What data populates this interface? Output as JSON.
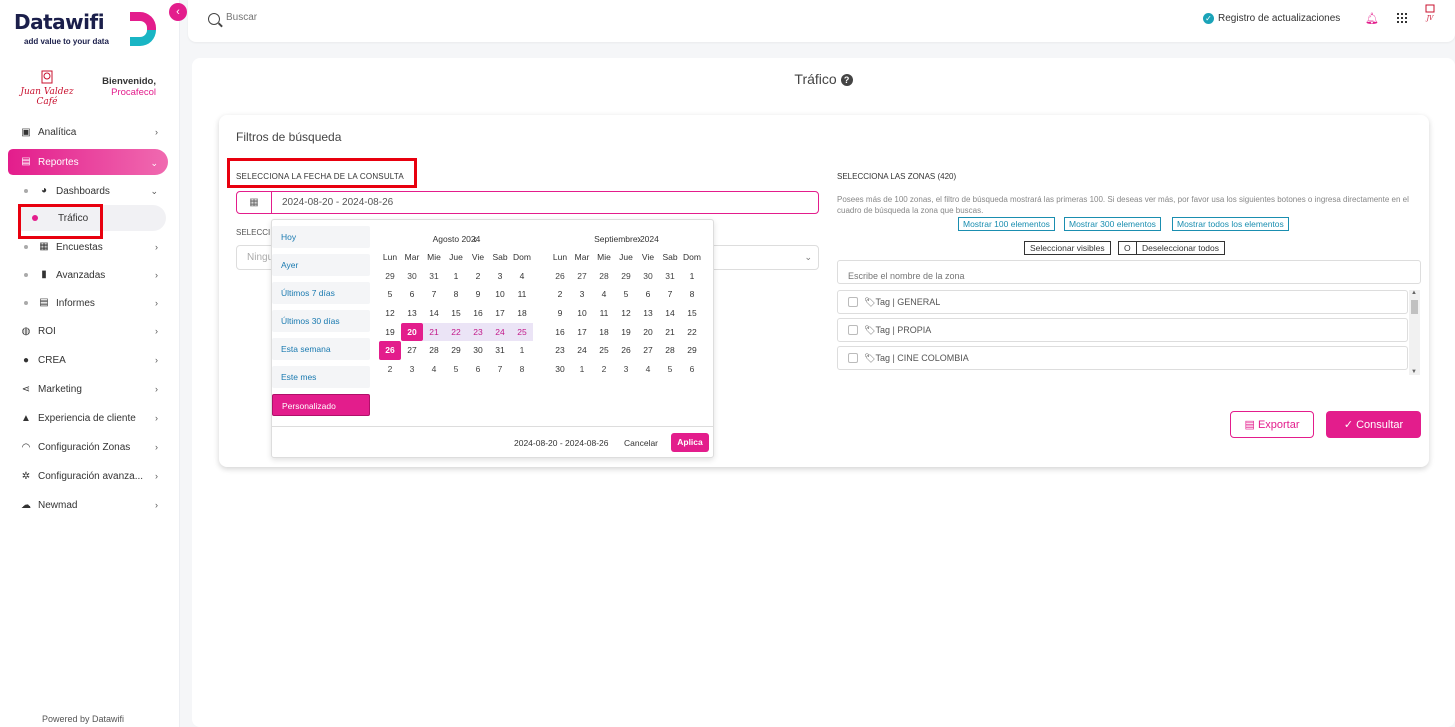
{
  "app": {
    "logo_text": "Datawifi",
    "logo_tagline": "add value to your data",
    "brand_name": "Juan Valdez Café",
    "welcome": "Bienvenido,",
    "company": "Procafecol",
    "powered_by": "Powered by Datawifi",
    "accent_color": "#e31d8c"
  },
  "topbar": {
    "search_placeholder": "Buscar",
    "updates_label": "Registro de actualizaciones"
  },
  "sidebar": {
    "items": [
      {
        "label": "Analítica",
        "icon": "chart-icon"
      },
      {
        "label": "Reportes",
        "icon": "document-icon"
      },
      {
        "label": "Dashboards",
        "icon": "speedometer-icon"
      },
      {
        "label": "Tráfico"
      },
      {
        "label": "Encuestas",
        "icon": "clipboard-icon"
      },
      {
        "label": "Avanzadas",
        "icon": "bar-chart-icon"
      },
      {
        "label": "Informes",
        "icon": "report-icon"
      },
      {
        "label": "ROI",
        "icon": "money-icon"
      },
      {
        "label": "CREA",
        "icon": "lightbulb-icon"
      },
      {
        "label": "Marketing",
        "icon": "share-icon"
      },
      {
        "label": "Experiencia de cliente",
        "icon": "thumbs-up-icon"
      },
      {
        "label": "Configuración Zonas",
        "icon": "wifi-icon"
      },
      {
        "label": "Configuración avanza...",
        "icon": "gear-icon"
      },
      {
        "label": "Newmad",
        "icon": "cloud-icon"
      }
    ]
  },
  "page": {
    "title": "Tráfico",
    "filters_title": "Filtros de búsqueda",
    "date_label": "SELECCIONA LA FECHA DE LA CONSULTA",
    "date_value": "2024-08-20 - 2024-08-26",
    "second_label": "SELECCI",
    "second_placeholder": "Ningu",
    "zones_label": "SELECCIONA LAS ZONAS (420)",
    "zones_hint": "Posees más de 100 zonas, el filtro de búsqueda mostrará las primeras 100. Si deseas ver más, por favor usa los siguientes botones o ingresa directamente en el cuadro de búsqueda la zona que buscas.",
    "show_100": "Mostrar 100 elementos",
    "show_300": "Mostrar 300 elementos",
    "show_all": "Mostrar todos los elementos",
    "select_visible": "Seleccionar visibles",
    "or": "O",
    "deselect_all": "Deseleccionar todos",
    "zone_search_placeholder": "Escribe el nombre de la zona",
    "zones": [
      "Tag | GENERAL",
      "Tag | PROPIA",
      "Tag | CINE COLOMBIA"
    ],
    "export_label": "Exportar",
    "consult_label": "Consultar"
  },
  "picker": {
    "ranges": [
      "Hoy",
      "Ayer",
      "Últimos 7 días",
      "Últimos 30 días",
      "Esta semana",
      "Este mes",
      "Personalizado"
    ],
    "active_range": "Personalizado",
    "weekdays": [
      "Lun",
      "Mar",
      "Mie",
      "Jue",
      "Vie",
      "Sab",
      "Dom"
    ],
    "left_month": "Agosto 2024",
    "right_month": "Septiembre 2024",
    "left_days": [
      "29",
      "30",
      "31",
      "1",
      "2",
      "3",
      "4",
      "5",
      "6",
      "7",
      "8",
      "9",
      "10",
      "11",
      "12",
      "13",
      "14",
      "15",
      "16",
      "17",
      "18",
      "19",
      "20",
      "21",
      "22",
      "23",
      "24",
      "25",
      "26",
      "27",
      "28",
      "29",
      "30",
      "31",
      "1",
      "2",
      "3",
      "4",
      "5",
      "6",
      "7",
      "8"
    ],
    "right_days": [
      "26",
      "27",
      "28",
      "29",
      "30",
      "31",
      "1",
      "2",
      "3",
      "4",
      "5",
      "6",
      "7",
      "8",
      "9",
      "10",
      "11",
      "12",
      "13",
      "14",
      "15",
      "16",
      "17",
      "18",
      "19",
      "20",
      "21",
      "22",
      "23",
      "24",
      "25",
      "26",
      "27",
      "28",
      "29",
      "30",
      "1",
      "2",
      "3",
      "4",
      "5",
      "6"
    ],
    "selected_range": "2024-08-20 - 2024-08-26",
    "cancel_label": "Cancelar",
    "apply_label": "Aplica"
  }
}
